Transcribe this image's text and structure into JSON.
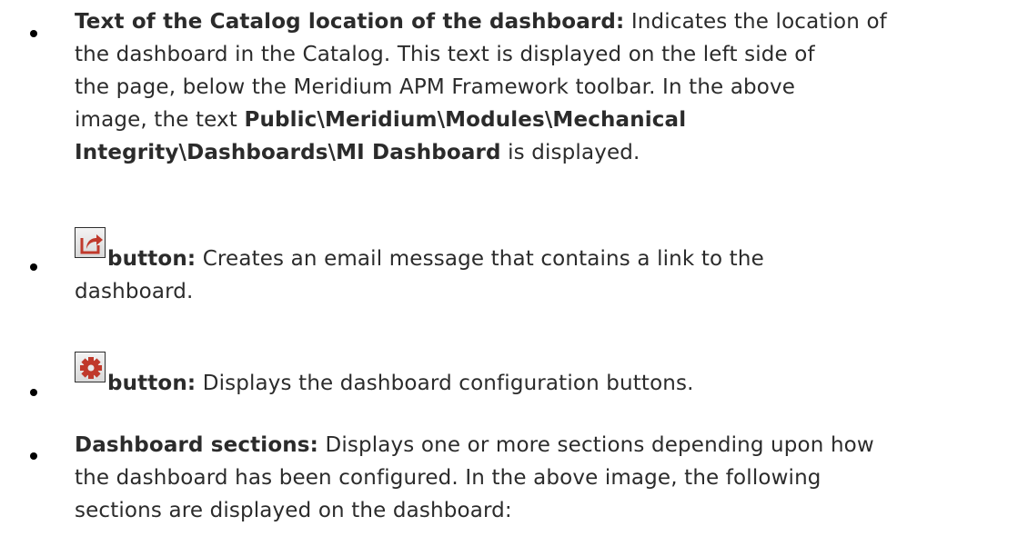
{
  "items": [
    {
      "term": "Text of the Catalog location of the dashboard:",
      "desc_line1": " Indicates the location of",
      "line2": "the dashboard in the Catalog. This text is displayed on the left side of",
      "line3": "the page, below the Meridium APM Framework toolbar. In the above",
      "line4_prefix": "image, the text ",
      "path_part1": "Public\\Meridium\\Modules\\Mechanical",
      "path_part2": "Integrity\\Dashboards\\MI Dashboard",
      "line5_suffix": " is displayed."
    },
    {
      "icon": "share-icon",
      "term": "button:",
      "desc_line1": " Creates an email message that contains a link to the",
      "line2": "dashboard."
    },
    {
      "icon": "gear-icon",
      "term": "button:",
      "desc_line1": " Displays the dashboard configuration buttons."
    },
    {
      "term": "Dashboard sections:",
      "desc_line1": " Displays one or more sections depending upon how",
      "line2": "the dashboard has been configured. In the above image, the following",
      "line3": "sections are displayed on the dashboard:"
    }
  ],
  "colors": {
    "text": "#2b2b2b",
    "icon_red": "#c0392b"
  }
}
